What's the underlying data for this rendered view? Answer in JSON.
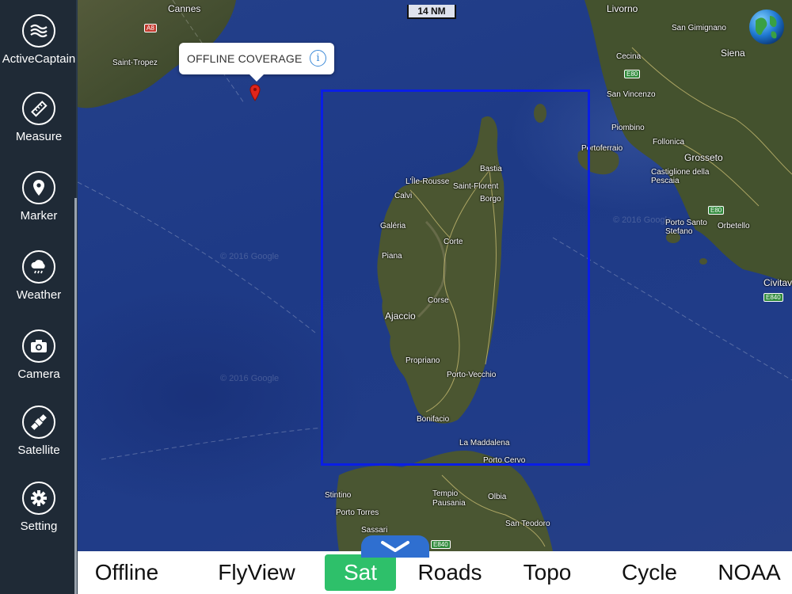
{
  "sidebar": {
    "items": [
      {
        "label": "ActiveCaptain",
        "icon": "waves-icon"
      },
      {
        "label": "Measure",
        "icon": "ruler-icon"
      },
      {
        "label": "Marker",
        "icon": "map-pin-icon"
      },
      {
        "label": "Weather",
        "icon": "cloud-rain-icon"
      },
      {
        "label": "Camera",
        "icon": "camera-icon"
      },
      {
        "label": "Satellite",
        "icon": "satellite-icon"
      },
      {
        "label": "Setting",
        "icon": "gear-icon"
      }
    ]
  },
  "map": {
    "scale": "14 NM",
    "callout": {
      "text": "OFFLINE COVERAGE",
      "info_icon": "info-icon"
    },
    "globe_icon": "globe-icon",
    "places": {
      "cannes": "Cannes",
      "a8": "A8",
      "saint_tropez": "Saint-Tropez",
      "livorno": "Livorno",
      "san_gimignano": "San Gimignano",
      "siena": "Siena",
      "cecina": "Cecina",
      "e80_1": "E80",
      "san_vincenzo": "San Vincenzo",
      "piombino": "Piombino",
      "follonica": "Follonica",
      "portoferraio": "Portoferraio",
      "grosseto": "Grosseto",
      "castiglione": "Castiglione della Pescaia",
      "porto_santo_stefano": "Porto Santo Stefano",
      "orbetello": "Orbetello",
      "e80_2": "E80",
      "civitav": "Civitav",
      "e840_1": "E840",
      "bastia": "Bastia",
      "ile_rousse": "L'Île-Rousse",
      "saint_florent": "Saint-Florent",
      "calvi": "Calvi",
      "borgo": "Borgo",
      "galeria": "Galéria",
      "corte": "Corte",
      "piana": "Piana",
      "corse": "Corse",
      "ajaccio": "Ajaccio",
      "propriano": "Propriano",
      "porto_vecchio": "Porto-Vecchio",
      "bonifacio": "Bonifacio",
      "la_maddalena": "La Maddalena",
      "porto_cervo": "Porto Cervo",
      "stintino": "Stintino",
      "tempio": "Tempio Pausania",
      "olbia": "Olbia",
      "porto_torres": "Porto Torres",
      "sassari": "Sassari",
      "san_teodoro": "San Teodoro",
      "e840_2": "E840"
    },
    "watermarks": [
      "© 2016 Google",
      "© 2016 Google",
      "© 2016 Google"
    ]
  },
  "tabs": [
    {
      "label": "Offline",
      "active": false
    },
    {
      "label": "FlyView",
      "active": false
    },
    {
      "label": "Sat",
      "active": true
    },
    {
      "label": "Roads",
      "active": false
    },
    {
      "label": "Topo",
      "active": false
    },
    {
      "label": "Cycle",
      "active": false
    },
    {
      "label": "NOAA",
      "active": false
    }
  ],
  "colors": {
    "sidebar_bg": "#1f2a36",
    "active_tab": "#2ec06a",
    "coverage_box": "#0a1ee6",
    "collapse_tab": "#2f6fd0"
  }
}
